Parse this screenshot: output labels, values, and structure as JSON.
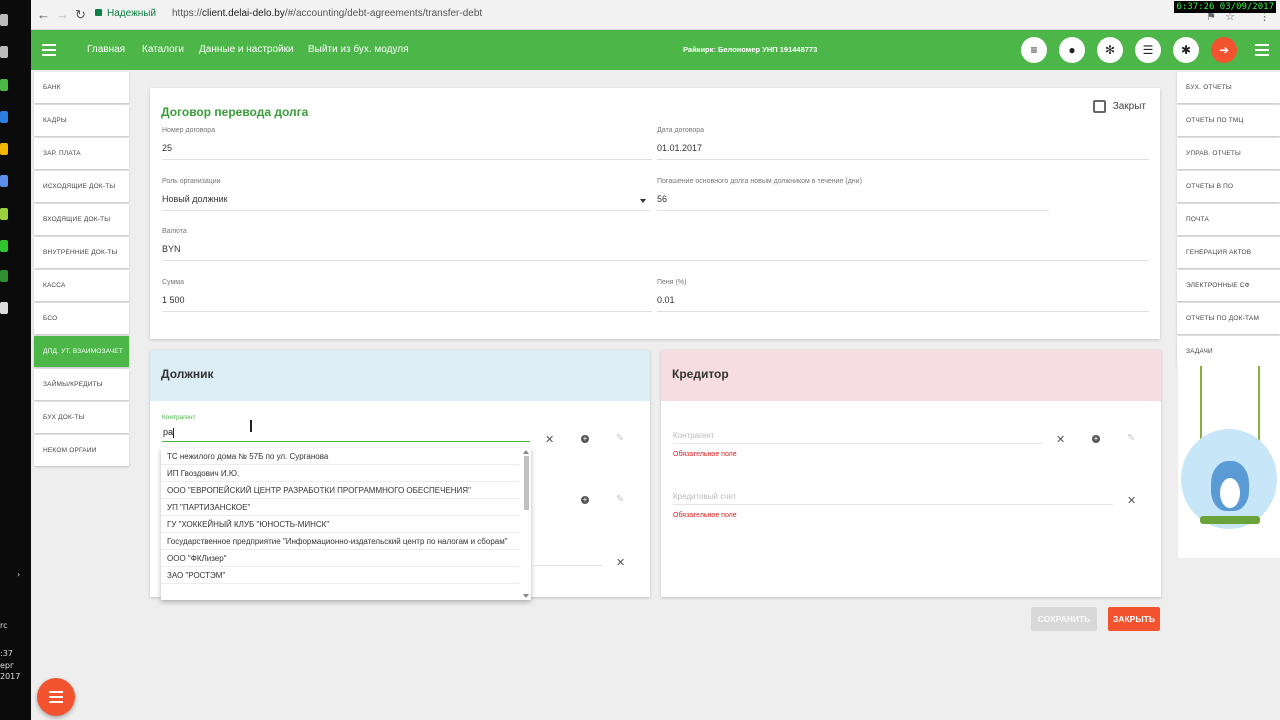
{
  "browser": {
    "secure_label": "Надежный",
    "url_scheme": "https://",
    "url_host": "client.delai-delo.by",
    "url_path": "/#/accounting/debt-agreements/transfer-debt",
    "clock": "6:37:26 03/09/2017"
  },
  "os": {
    "texts": [
      "rc",
      ":37",
      "ерг",
      "2017"
    ]
  },
  "appbar": {
    "menu": [
      "Главная",
      "Каталоги",
      "Данные и настройки",
      "Выйти из бух. модуля"
    ],
    "payer": "Райкирк: Белономер УНП 191448773",
    "icons": [
      "database-icon",
      "user-icon",
      "gear-icon",
      "list-icon",
      "bug-icon",
      "exit-icon"
    ]
  },
  "left_menu": [
    "Банк",
    "Кадры",
    "Зар. плата",
    "Исходящие док-ты",
    "Входящие док-ты",
    "Внутренние док-ты",
    "Касса",
    "БСО",
    "Дпд. ут. взаимозачет",
    "Займы/кредиты",
    "Бух док-ты",
    "Неком оргаии"
  ],
  "left_menu_active_index": 8,
  "right_menu": [
    "Бух. отчеты",
    "Отчеты по ТМЦ",
    "Управ. отчеты",
    "Отчеты в ПО",
    "Почта",
    "Генерация актов",
    "Электронные СФ",
    "Отчеты по док-там",
    "Задачи"
  ],
  "form": {
    "title": "Договор перевода долга",
    "closed_label": "Закрыт",
    "contract_number_label": "Номер договора",
    "contract_number": "25",
    "contract_date_label": "Дата договора",
    "contract_date": "01.01.2017",
    "role_label": "Роль организации",
    "role": "Новый должник",
    "repay_label": "Погашение основного долга новым должником в течение (дни)",
    "repay_days": "56",
    "currency_label": "Валюта",
    "currency": "BYN",
    "sum_label": "Сумма",
    "sum": "1 500",
    "penalty_label": "Пеня (%)",
    "penalty": "0.01"
  },
  "debtor": {
    "title": "Должник",
    "counterparty_label": "Контрагент",
    "counterparty_value": "ра"
  },
  "creditor": {
    "title": "Кредитор",
    "counterparty_placeholder": "Контрагент",
    "credit_account_placeholder": "Кредитовый счет",
    "required_text": "Обязательное поле"
  },
  "dropdown_items": [
    "ТС нежилого дома № 57Б по ул. Сурганова",
    "ИП Гвоздович И.Ю.",
    "ООО \"ЕВРОПЕЙСКИЙ ЦЕНТР РАЗРАБОТКИ ПРОГРАММНОГО ОБЕСПЕЧЕНИЯ\"",
    "УП \"ПАРТИЗАНСКОЕ\"",
    "ГУ \"ХОККЕЙНЫЙ КЛУБ \"ЮНОСТЬ-МИНСК\"",
    "Государственное предприятие \"Информационно-издательский центр по налогам и сборам\"",
    "ООО \"ФКЛизер\"",
    "ЗАО \"РОСТЭМ\""
  ],
  "buttons": {
    "save": "Сохранить",
    "close": "Закрыть"
  }
}
